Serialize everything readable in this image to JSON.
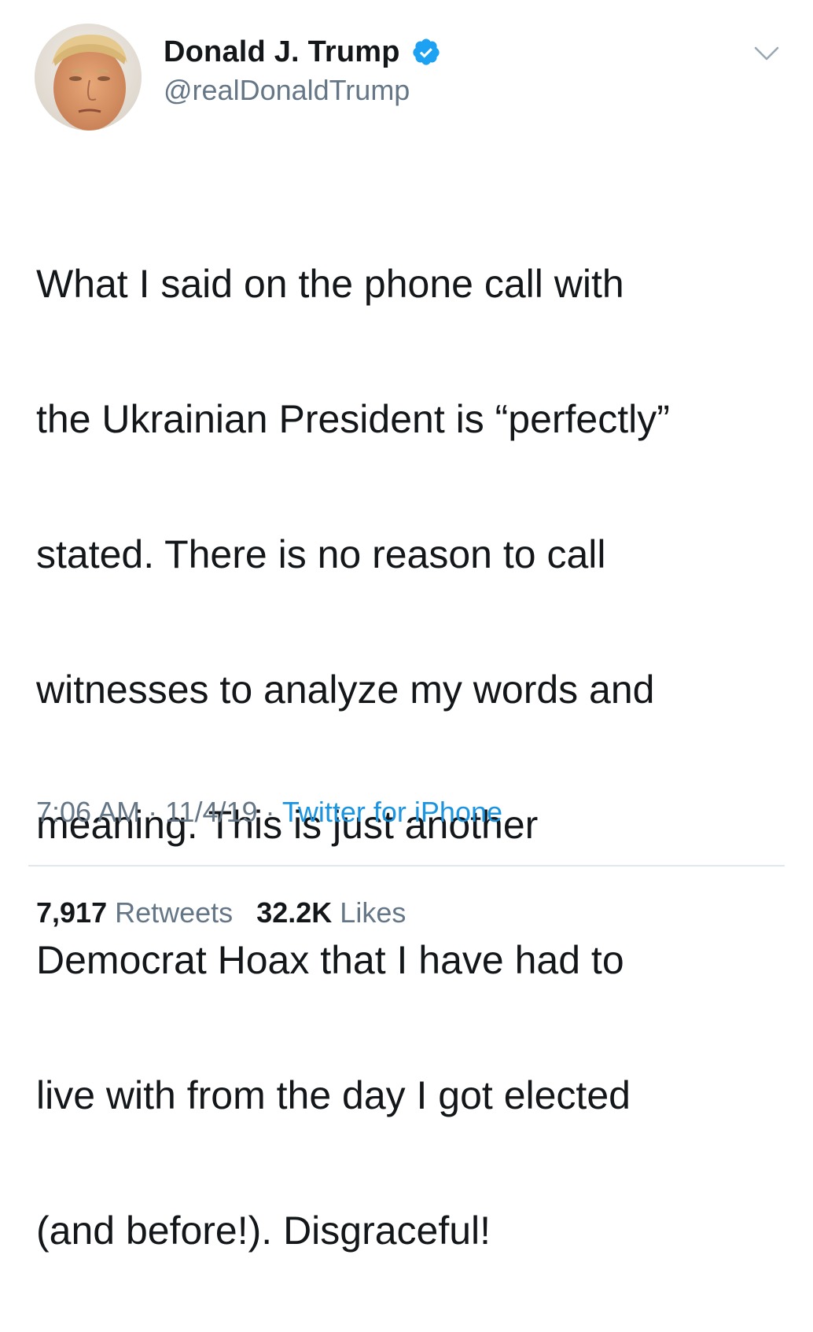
{
  "author": {
    "display_name": "Donald J. Trump",
    "handle": "@realDonaldTrump",
    "verified": true,
    "verified_badge_color": "#1da1f2"
  },
  "tweet": {
    "lines": [
      "What I said on the phone call with",
      "the Ukrainian President is “perfectly”",
      "stated. There is no reason to call",
      "witnesses to analyze my words and",
      "meaning. This is just another",
      "Democrat Hoax that I have had to",
      "live with from the day I got elected",
      "(and before!). Disgraceful!"
    ]
  },
  "meta": {
    "time": "7:06 AM",
    "separator": " · ",
    "date": "11/4/19",
    "source": "Twitter for iPhone"
  },
  "stats": {
    "retweets_count": "7,917",
    "retweets_label": "Retweets",
    "likes_count": "32.2K",
    "likes_label": "Likes"
  },
  "colors": {
    "text": "#14171a",
    "secondary": "#657786",
    "link": "#1b95e0",
    "divider": "#e1e8ed"
  }
}
